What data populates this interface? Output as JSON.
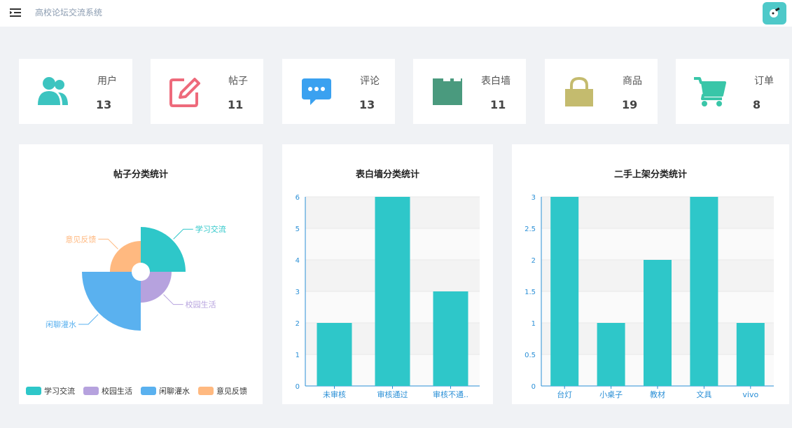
{
  "header": {
    "title": "高校论坛交流系统"
  },
  "stats": [
    {
      "label": "用户",
      "value": "13",
      "icon": "users-icon",
      "color": "#3cc4c0"
    },
    {
      "label": "帖子",
      "value": "11",
      "icon": "edit-icon",
      "color": "#ee6a7b"
    },
    {
      "label": "评论",
      "value": "13",
      "icon": "comment-icon",
      "color": "#3aa1f0"
    },
    {
      "label": "表白墙",
      "value": "11",
      "icon": "board-icon",
      "color": "#4a9a7e"
    },
    {
      "label": "商品",
      "value": "19",
      "icon": "lock-icon",
      "color": "#c4bb6e"
    },
    {
      "label": "订单",
      "value": "8",
      "icon": "cart-icon",
      "color": "#39c6a8"
    }
  ],
  "chart_data": [
    {
      "type": "pie",
      "title": "帖子分类统计",
      "categories": [
        "学习交流",
        "校园生活",
        "闲聊灌水",
        "意见反馈"
      ],
      "values": [
        4,
        2,
        6,
        2
      ],
      "colors": [
        "#2ec7c9",
        "#b6a2de",
        "#5ab1ef",
        "#ffb980"
      ],
      "legend": "bottom"
    },
    {
      "type": "bar",
      "title": "表白墙分类统计",
      "categories": [
        "未审核",
        "审核通过",
        "审核不通.."
      ],
      "values": [
        2,
        6,
        3
      ],
      "ylim": [
        0,
        6
      ],
      "yticks": [
        "0",
        "1",
        "2",
        "3",
        "4",
        "5",
        "6"
      ],
      "color": "#2ec7c9"
    },
    {
      "type": "bar",
      "title": "二手上架分类统计",
      "categories": [
        "台灯",
        "小桌子",
        "教材",
        "文具",
        "vivo"
      ],
      "values": [
        3,
        1,
        2,
        3,
        1
      ],
      "ylim": [
        0,
        3
      ],
      "yticks": [
        "0",
        "0.5",
        "1",
        "1.5",
        "2",
        "2.5",
        "3"
      ],
      "color": "#2ec7c9"
    }
  ]
}
